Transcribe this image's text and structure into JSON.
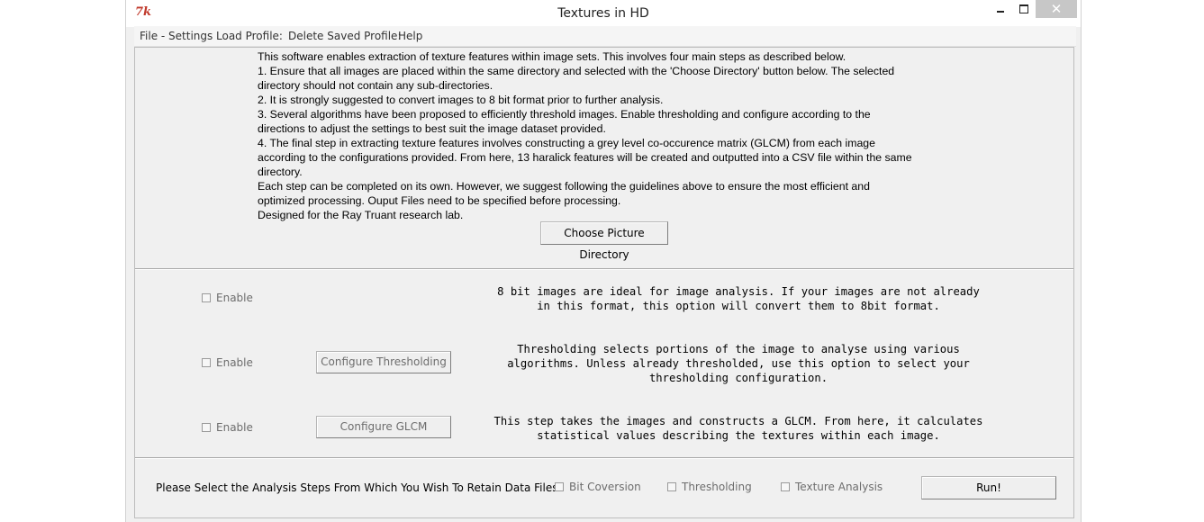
{
  "window": {
    "title": "Textures in HD",
    "app_icon_glyph": "7k",
    "close_glyph": "✕"
  },
  "menu": [
    "File - Settings",
    "Load Profile:",
    "Delete Saved Profile:",
    "Help"
  ],
  "intro_lines": [
    "This software enables extraction of texture features within image sets. This involves four main steps as described below.",
    "1. Ensure that all images are placed within the same directory and selected with the 'Choose Directory' button below. The selected",
    "directory should not contain any sub-directories.",
    "2. It is strongly suggested to convert images to 8 bit format prior to further analysis.",
    "3. Several algorithms have been proposed to efficiently threshold images. Enable thresholding and configure according to the",
    "directions to adjust the settings to best suit the image dataset provided.",
    "4. The final step in extracting texture features involves constructing a grey level co-occurence matrix (GLCM) from each image",
    "according to the configurations provided. From here, 13 haralick features will be created and outputted into a CSV file within the same",
    "directory.",
    "Each step can be completed on its own. However, we suggest following the guidelines above to ensure the most efficient and",
    "optimized processing. Ouput Files need to be specified before processing.",
    "Designed for the Ray Truant research lab."
  ],
  "choose_button": "Choose Picture Directory",
  "steps": {
    "bit": {
      "enable_label": "Enable",
      "desc": "8 bit images are ideal for image analysis. If your images are not already\nin this format, this option will convert them to 8bit format."
    },
    "threshold": {
      "enable_label": "Enable",
      "button": "Configure Thresholding",
      "desc": "Thresholding selects portions of the image to analyse using various\nalgorithms. Unless already thresholded, use this option to select your\nthresholding configuration."
    },
    "glcm": {
      "enable_label": "Enable",
      "button": "Configure GLCM",
      "desc": "This step takes the images and constructs a GLCM. From here, it calculates\nstatistical values describing the textures within each image."
    }
  },
  "retain": {
    "label": "Please Select the Analysis Steps From Which You Wish To Retain Data Files:",
    "options": [
      "Bit Coversion",
      "Thresholding",
      "Texture Analysis"
    ],
    "run_button": "Run!"
  },
  "colors": {
    "window_bg": "#f0f0f0",
    "close_button_bg": "#c7c7c7",
    "disabled_text": "#6d6d6d"
  }
}
